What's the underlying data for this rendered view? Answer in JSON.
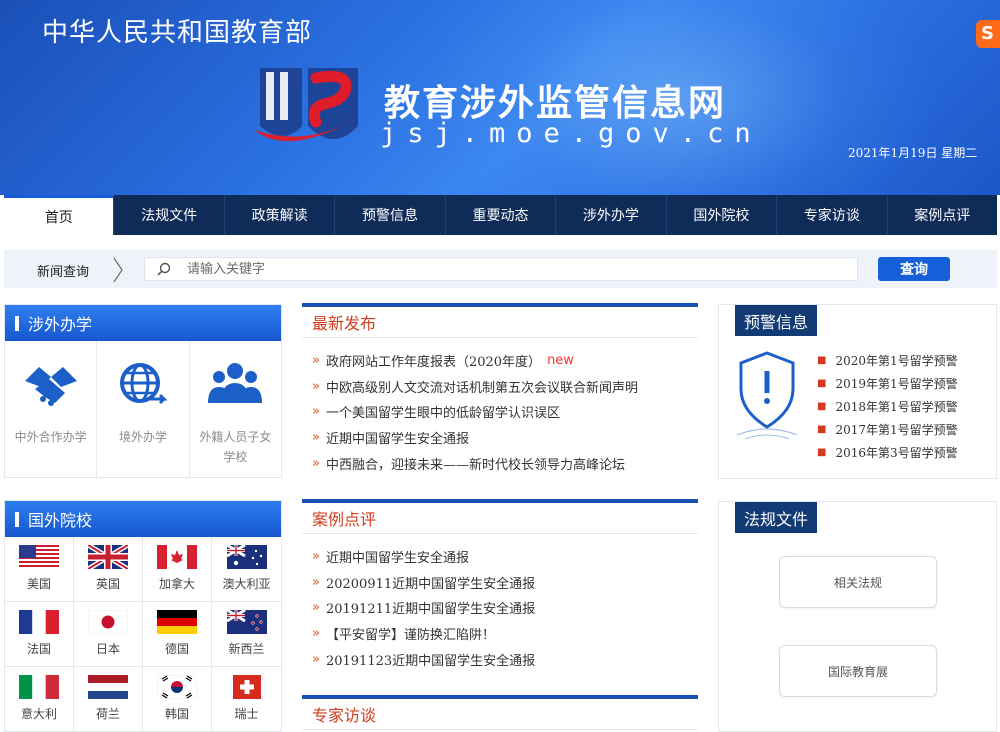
{
  "header": {
    "ministry": "中华人民共和国教育部",
    "site_name": "教育涉外监管信息网",
    "domain": "jsj.moe.gov.cn",
    "date": "2021年1月19日  星期二",
    "corner_badge": "S"
  },
  "nav": {
    "items": [
      {
        "label": "首页",
        "active": true
      },
      {
        "label": "法规文件"
      },
      {
        "label": "政策解读"
      },
      {
        "label": "预警信息"
      },
      {
        "label": "重要动态"
      },
      {
        "label": "涉外办学"
      },
      {
        "label": "国外院校"
      },
      {
        "label": "专家访谈"
      },
      {
        "label": "案例点评"
      }
    ]
  },
  "search": {
    "label": "新闻查询",
    "placeholder": "请输入关键字",
    "button": "查询"
  },
  "sheweibanxue": {
    "title": "涉外办学",
    "items": [
      {
        "label": "中外合作办学",
        "icon": "handshake-icon"
      },
      {
        "label": "境外办学",
        "icon": "globe-icon"
      },
      {
        "label": "外籍人员子女学校",
        "icon": "people-icon"
      }
    ]
  },
  "guowaiyuanxiao": {
    "title": "国外院校",
    "countries": [
      {
        "name": "美国",
        "flag": "us-flag-icon"
      },
      {
        "name": "英国",
        "flag": "uk-flag-icon"
      },
      {
        "name": "加拿大",
        "flag": "canada-flag-icon"
      },
      {
        "name": "澳大利亚",
        "flag": "australia-flag-icon"
      },
      {
        "name": "法国",
        "flag": "france-flag-icon"
      },
      {
        "name": "日本",
        "flag": "japan-flag-icon"
      },
      {
        "name": "德国",
        "flag": "germany-flag-icon"
      },
      {
        "name": "新西兰",
        "flag": "new-zealand-flag-icon"
      },
      {
        "name": "意大利",
        "flag": "italy-flag-icon"
      },
      {
        "name": "荷兰",
        "flag": "netherlands-flag-icon"
      },
      {
        "name": "韩国",
        "flag": "korea-flag-icon"
      },
      {
        "name": "瑞士",
        "flag": "switzerland-flag-icon"
      }
    ]
  },
  "latest": {
    "title": "最新发布",
    "items": [
      {
        "text": "政府网站工作年度报表（2020年度）",
        "badge": "new"
      },
      {
        "text": "中欧高级别人文交流对话机制第五次会议联合新闻声明"
      },
      {
        "text": "一个美国留学生眼中的低龄留学认识误区"
      },
      {
        "text": "近期中国留学生安全通报"
      },
      {
        "text": "中西融合，迎接未来——新时代校长领导力高峰论坛"
      }
    ]
  },
  "cases": {
    "title": "案例点评",
    "items": [
      {
        "text": "近期中国留学生安全通报"
      },
      {
        "text": "20200911近期中国留学生安全通报"
      },
      {
        "text": "20191211近期中国留学生安全通报"
      },
      {
        "text": "【平安留学】谨防换汇陷阱！"
      },
      {
        "text": "20191123近期中国留学生安全通报"
      }
    ]
  },
  "experts": {
    "title": "专家访谈"
  },
  "warnings": {
    "title": "预警信息",
    "icon": "shield-alert-icon",
    "items": [
      "2020年第1号留学预警",
      "2019年第1号留学预警",
      "2018年第1号留学预警",
      "2017年第1号留学预警",
      "2016年第3号留学预警"
    ]
  },
  "laws": {
    "title": "法规文件",
    "buttons": [
      "相关法规",
      "国际教育展"
    ]
  },
  "colors": {
    "banner": "#2a6fe0",
    "nav": "#0f2b57",
    "accent": "#1560d8",
    "headline": "#d23c1e"
  }
}
